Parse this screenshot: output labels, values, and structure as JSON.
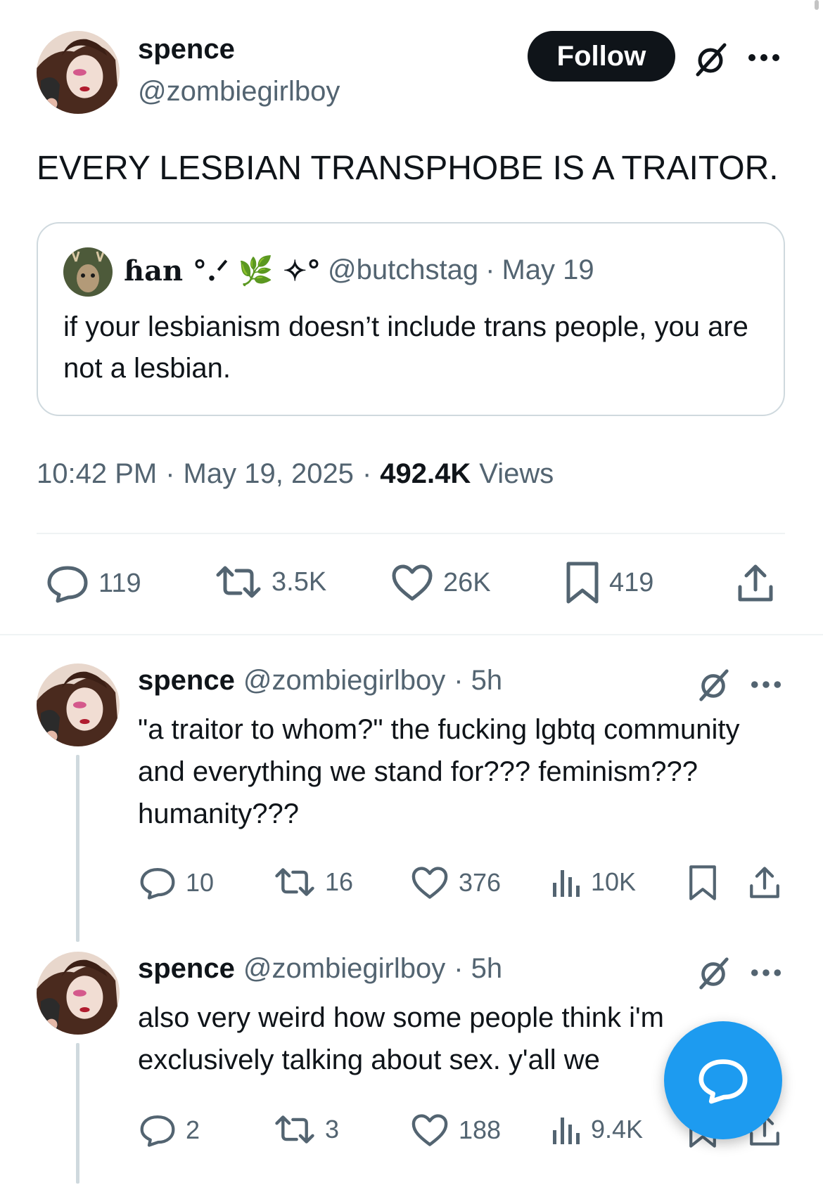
{
  "colors": {
    "accent": "#1d9bf0",
    "text": "#0f1419",
    "muted": "#536471",
    "border": "#cfd9de"
  },
  "main_tweet": {
    "display_name": "spence",
    "handle": "@zombiegirlboy",
    "follow_label": "Follow",
    "text": "EVERY LESBIAN TRANSPHOBE IS A TRAITOR.",
    "quote": {
      "display_name": "ɦan °.ᐟ 🌿 ✧°",
      "handle": "@butchstag",
      "sep": "·",
      "date": "May 19",
      "text": "if your lesbianism doesn’t include trans people, you are not a lesbian."
    },
    "time": "10:42 PM",
    "date": "May 19, 2025",
    "views_count": "492.4K",
    "views_label": "Views",
    "stats": {
      "replies": "119",
      "reposts": "3.5K",
      "likes": "26K",
      "bookmarks": "419"
    }
  },
  "replies": [
    {
      "display_name": "spence",
      "handle": "@zombiegirlboy",
      "time": "· 5h",
      "text": "\"a traitor to whom?\" the fucking lgbtq community and everything we stand for??? feminism??? humanity???",
      "stats": {
        "replies": "10",
        "reposts": "16",
        "likes": "376",
        "views": "10K"
      }
    },
    {
      "display_name": "spence",
      "handle": "@zombiegirlboy",
      "time": "· 5h",
      "text": "also very weird how some people think i'm exclusively talking about sex. y'all we",
      "stats": {
        "replies": "2",
        "reposts": "3",
        "likes": "188",
        "views": "9.4K"
      }
    }
  ],
  "icons": [
    "grok-icon",
    "more-icon",
    "reply-icon",
    "repost-icon",
    "like-icon",
    "bookmark-icon",
    "share-icon",
    "views-icon",
    "compose-message-icon"
  ]
}
